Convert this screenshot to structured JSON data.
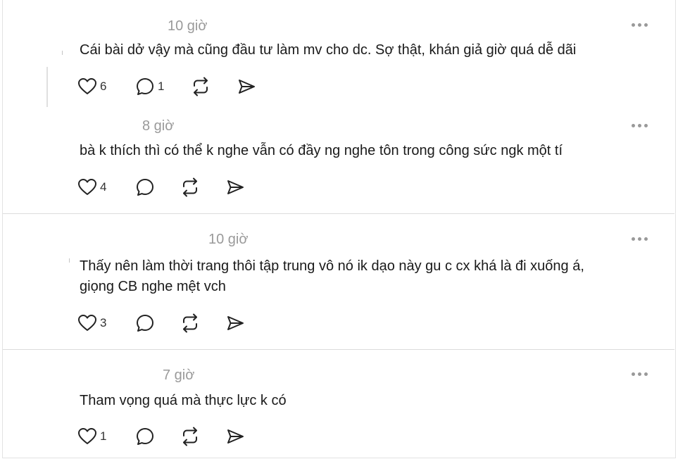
{
  "comments": [
    {
      "time": "10 giờ",
      "lines": [
        "Cái bài dở vậy mà cũng đầu tư làm mv cho dc. Sợ thật, khán giả giờ quá dễ dãi"
      ],
      "likes": "6",
      "replies": "1"
    },
    {
      "time": "8 giờ",
      "lines": [
        "bà k thích thì có thể k nghe vẫn có đầy ng nghe tôn trong công sức ngk một tí"
      ],
      "likes": "4",
      "replies": ""
    },
    {
      "time": "10 giờ",
      "lines": [
        "Thấy nên làm thời trang thôi tập trung vô nó ik dạo này gu c cx khá là đi xuống á,",
        "giọng CB nghe mệt vch"
      ],
      "likes": "3",
      "replies": ""
    },
    {
      "time": "7 giờ",
      "lines": [
        "Tham vọng quá mà thực lực k có"
      ],
      "likes": "1",
      "replies": ""
    }
  ],
  "icons": {
    "like": "heart-icon",
    "reply": "comment-bubble-icon",
    "repost": "repost-icon",
    "share": "send-icon",
    "more": "more-dots-icon"
  },
  "colors": {
    "text": "#1a1a1a",
    "meta": "#9a9a9a",
    "icon": "#222222",
    "divider": "#dcdcdc"
  }
}
